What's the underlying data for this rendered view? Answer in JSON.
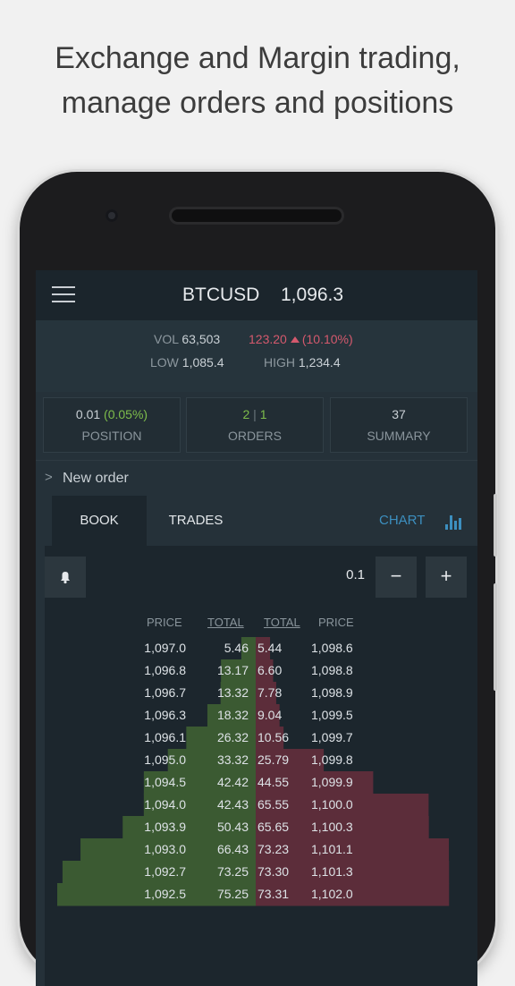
{
  "headline": {
    "line1": "Exchange and Margin trading,",
    "line2": "manage orders and positions"
  },
  "appbar": {
    "pair": "BTCUSD",
    "price": "1,096.3",
    "menu_icon": "hamburger-menu-icon"
  },
  "stats": {
    "vol_label": "VOL",
    "vol_value": "63,503",
    "change_value": "123.20",
    "change_pct": "(10.10%)",
    "low_label": "LOW",
    "low_value": "1,085.4",
    "high_label": "HIGH",
    "high_value": "1,234.4"
  },
  "cards": {
    "position": {
      "value": "0.01",
      "pct": "(0.05%)",
      "label": "POSITION"
    },
    "orders": {
      "active": "2",
      "sep": "|",
      "other": "1",
      "label": "ORDERS"
    },
    "summary": {
      "value": "37",
      "label": "SUMMARY"
    }
  },
  "new_order": {
    "chevron": ">",
    "label": "New order"
  },
  "tabs": {
    "book": "BOOK",
    "trades": "TRADES",
    "chart": "CHART",
    "chart_icon": "bar-chart-icon"
  },
  "controls": {
    "bell_icon": "bell-icon",
    "amount": "0.1",
    "minus": "−",
    "plus": "+"
  },
  "book": {
    "headers": {
      "price_bid": "PRICE",
      "total_bid": "TOTAL",
      "total_ask": "TOTAL",
      "price_ask": "PRICE"
    },
    "rows": [
      {
        "bid_price": "1,097.0",
        "bid_total": "5.46",
        "ask_total": "5.44",
        "ask_price": "1,098.6"
      },
      {
        "bid_price": "1,096.8",
        "bid_total": "13.17",
        "ask_total": "6.60",
        "ask_price": "1,098.8"
      },
      {
        "bid_price": "1,096.7",
        "bid_total": "13.32",
        "ask_total": "7.78",
        "ask_price": "1,098.9"
      },
      {
        "bid_price": "1,096.3",
        "bid_total": "18.32",
        "ask_total": "9.04",
        "ask_price": "1,099.5"
      },
      {
        "bid_price": "1,096.1",
        "bid_total": "26.32",
        "ask_total": "10.56",
        "ask_price": "1,099.7"
      },
      {
        "bid_price": "1,095.0",
        "bid_total": "33.32",
        "ask_total": "25.79",
        "ask_price": "1,099.8"
      },
      {
        "bid_price": "1,094.5",
        "bid_total": "42.42",
        "ask_total": "44.55",
        "ask_price": "1,099.9"
      },
      {
        "bid_price": "1,094.0",
        "bid_total": "42.43",
        "ask_total": "65.55",
        "ask_price": "1,100.0"
      },
      {
        "bid_price": "1,093.9",
        "bid_total": "50.43",
        "ask_total": "65.65",
        "ask_price": "1,100.3"
      },
      {
        "bid_price": "1,093.0",
        "bid_total": "66.43",
        "ask_total": "73.23",
        "ask_price": "1,101.1"
      },
      {
        "bid_price": "1,092.7",
        "bid_total": "73.25",
        "ask_total": "73.30",
        "ask_price": "1,101.3"
      },
      {
        "bid_price": "1,092.5",
        "bid_total": "75.25",
        "ask_total": "73.31",
        "ask_price": "1,102.0"
      }
    ]
  },
  "colors": {
    "bid_depth": "#3b5a32",
    "ask_depth": "#5c2d3a",
    "accent": "#3c8fbf",
    "positive": "#7ebd4b",
    "negative": "#d4596d"
  }
}
